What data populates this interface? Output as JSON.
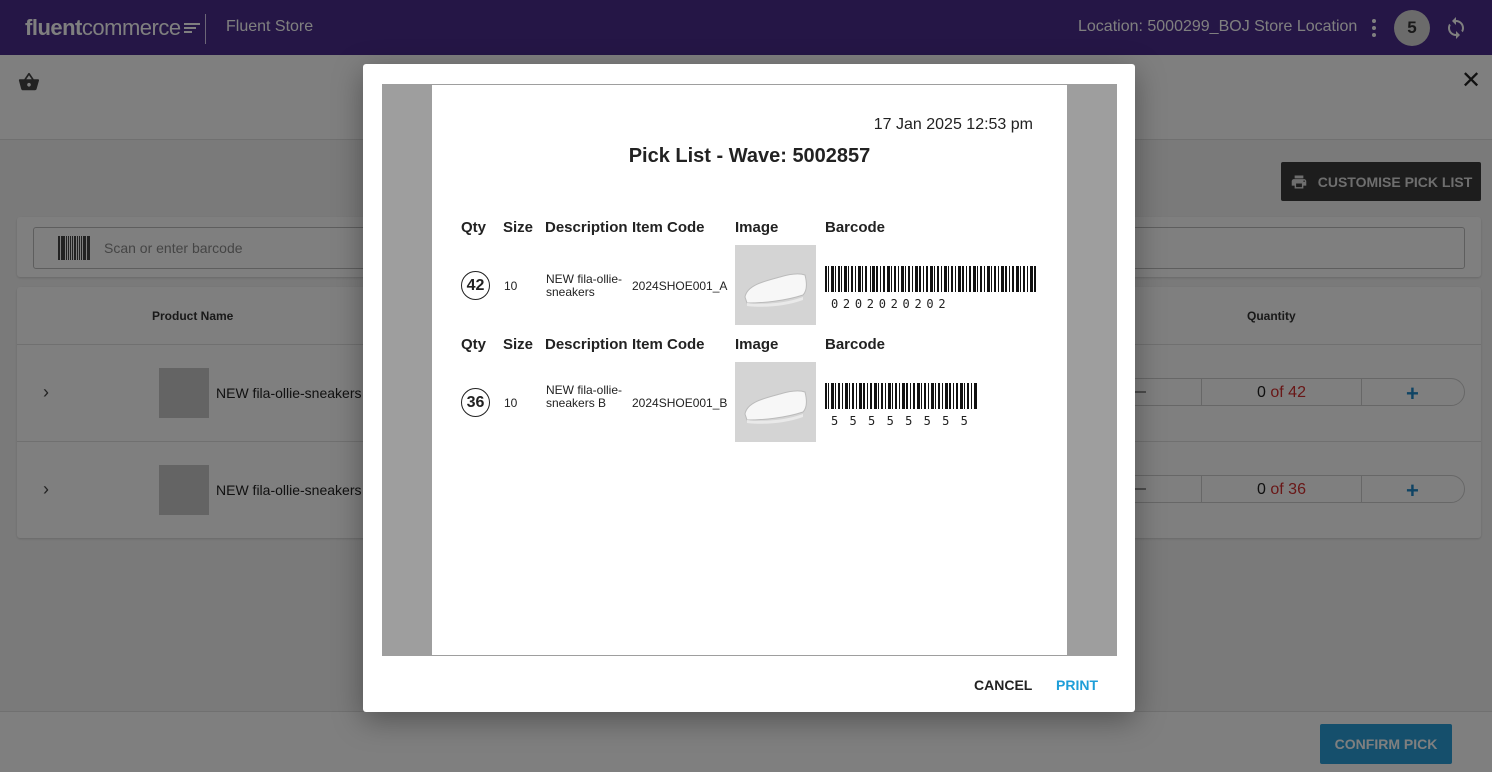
{
  "header": {
    "logo_bold": "fluent",
    "logo_thin": "commerce",
    "store_name": "Fluent Store",
    "location": "Location: 5000299_BOJ Store Location",
    "avatar_initial": "5",
    "bg_color": "#4b2d8c"
  },
  "toolbar": {
    "customise_label": "CUSTOMISE PICK LIST"
  },
  "scan": {
    "placeholder": "Scan or enter barcode"
  },
  "table": {
    "col_product": "Product Name",
    "col_quantity": "Quantity",
    "rows": [
      {
        "name": "NEW fila-ollie-sneakers",
        "picked": "0",
        "of_total": " of 42"
      },
      {
        "name": "NEW fila-ollie-sneakers",
        "picked": "0",
        "of_total": " of 36"
      }
    ]
  },
  "footer": {
    "confirm_label": "CONFIRM PICK",
    "accent": "#2b9fd9"
  },
  "modal": {
    "date": "17 Jan 2025 12:53 pm",
    "title": "Pick List - Wave: 5002857",
    "headers": {
      "qty": "Qty",
      "size": "Size",
      "description": "Description",
      "item_code": "Item Code",
      "image": "Image",
      "barcode": "Barcode"
    },
    "items": [
      {
        "qty": "42",
        "size": "10",
        "description": "NEW fila-ollie-sneakers",
        "item_code": "2024SHOE001_A",
        "barcode": "0202020202"
      },
      {
        "qty": "36",
        "size": "10",
        "description": "NEW fila-ollie-sneakers B",
        "item_code": "2024SHOE001_B",
        "barcode": "55555555"
      }
    ],
    "cancel_label": "CANCEL",
    "print_label": "PRINT",
    "print_color": "#1e9ed8"
  }
}
